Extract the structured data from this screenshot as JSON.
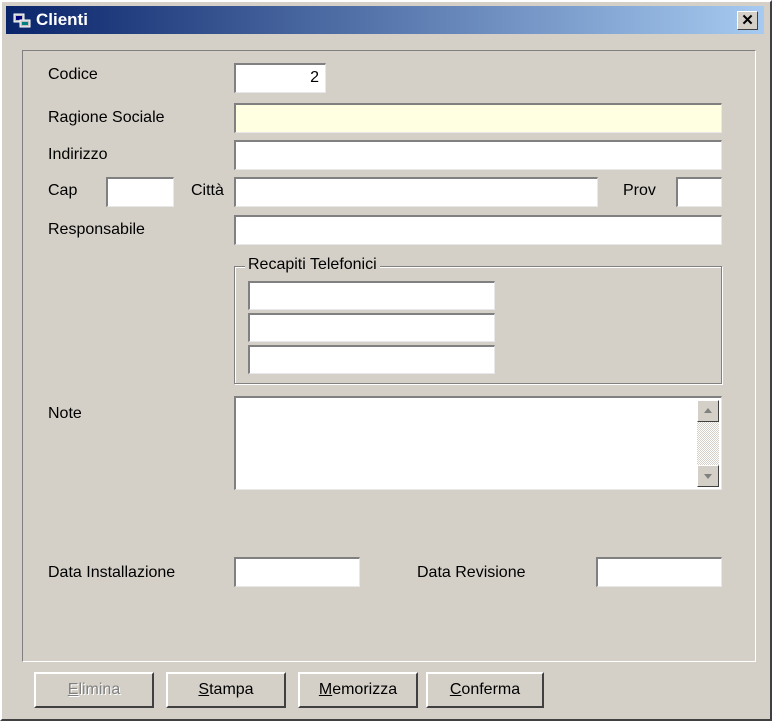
{
  "window": {
    "title": "Clienti",
    "close_glyph": "✕",
    "icon": "window-app-icon"
  },
  "labels": {
    "codice": "Codice",
    "ragione_sociale": "Ragione Sociale",
    "indirizzo": "Indirizzo",
    "cap": "Cap",
    "citta": "Città",
    "prov": "Prov",
    "responsabile": "Responsabile",
    "recapiti": "Recapiti Telefonici",
    "note": "Note",
    "data_installazione": "Data Installazione",
    "data_revisione": "Data Revisione"
  },
  "values": {
    "codice": "2",
    "ragione_sociale": "",
    "indirizzo": "",
    "cap": "",
    "citta": "",
    "prov": "",
    "responsabile": "",
    "telefono_1": "",
    "telefono_2": "",
    "telefono_3": "",
    "note": "",
    "data_installazione": "",
    "data_revisione": ""
  },
  "buttons": {
    "elimina": {
      "mnemonic": "E",
      "rest": "limina",
      "enabled": false
    },
    "stampa": {
      "mnemonic": "S",
      "rest": "tampa",
      "enabled": true
    },
    "memorizza": {
      "mnemonic": "M",
      "rest": "emorizza",
      "enabled": true
    },
    "conferma": {
      "mnemonic": "C",
      "rest": "onferma",
      "enabled": true
    }
  },
  "colors": {
    "titlebar_start": "#0a246a",
    "titlebar_end": "#a6caf0",
    "highlight_field": "#ffffe1",
    "face": "#d4d0c8"
  }
}
